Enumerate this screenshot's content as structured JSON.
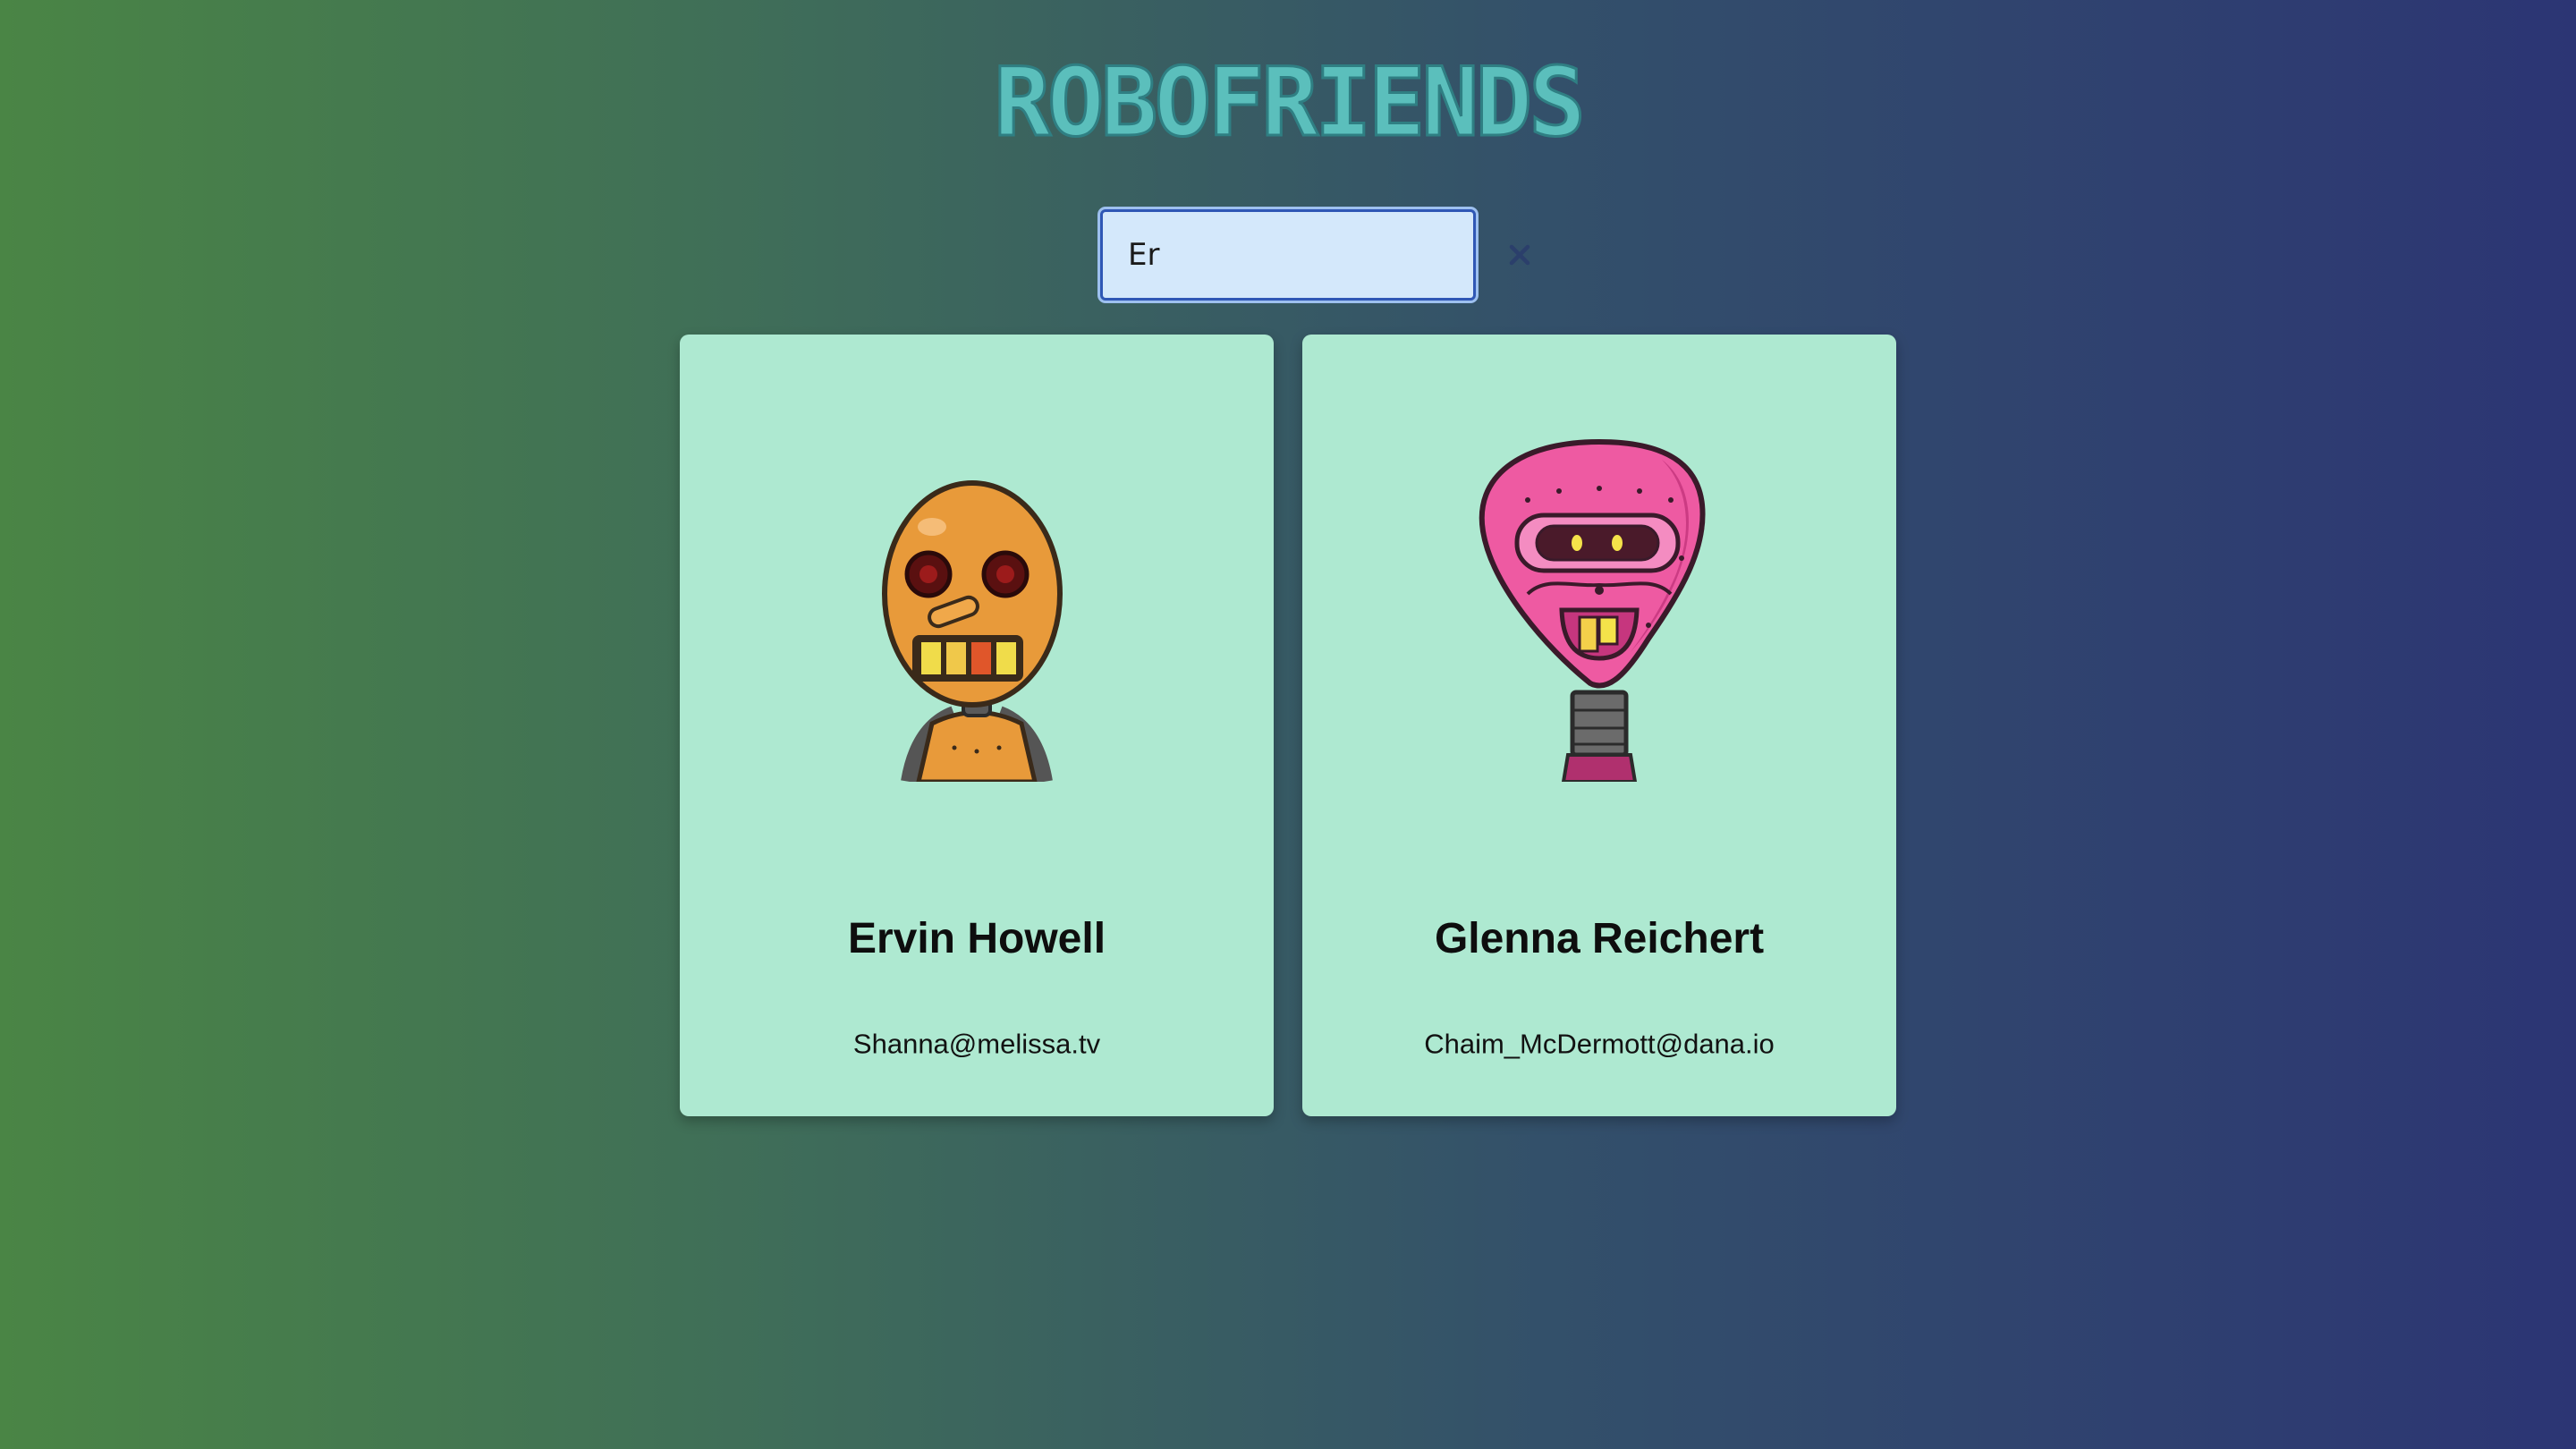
{
  "app": {
    "title": "ROBOFRIENDS"
  },
  "search": {
    "value": "Er",
    "clear_icon": "close-icon"
  },
  "robots": [
    {
      "name": "Ervin Howell",
      "email": "Shanna@melissa.tv",
      "image": "orange-robot-avatar"
    },
    {
      "name": "Glenna Reichert",
      "email": "Chaim_McDermott@dana.io",
      "image": "pink-robot-avatar"
    }
  ],
  "colors": {
    "title": "#5bbfbc",
    "card_background": "#aee9d1",
    "search_border": "#2f57b5",
    "search_background": "#d4e8fb"
  }
}
